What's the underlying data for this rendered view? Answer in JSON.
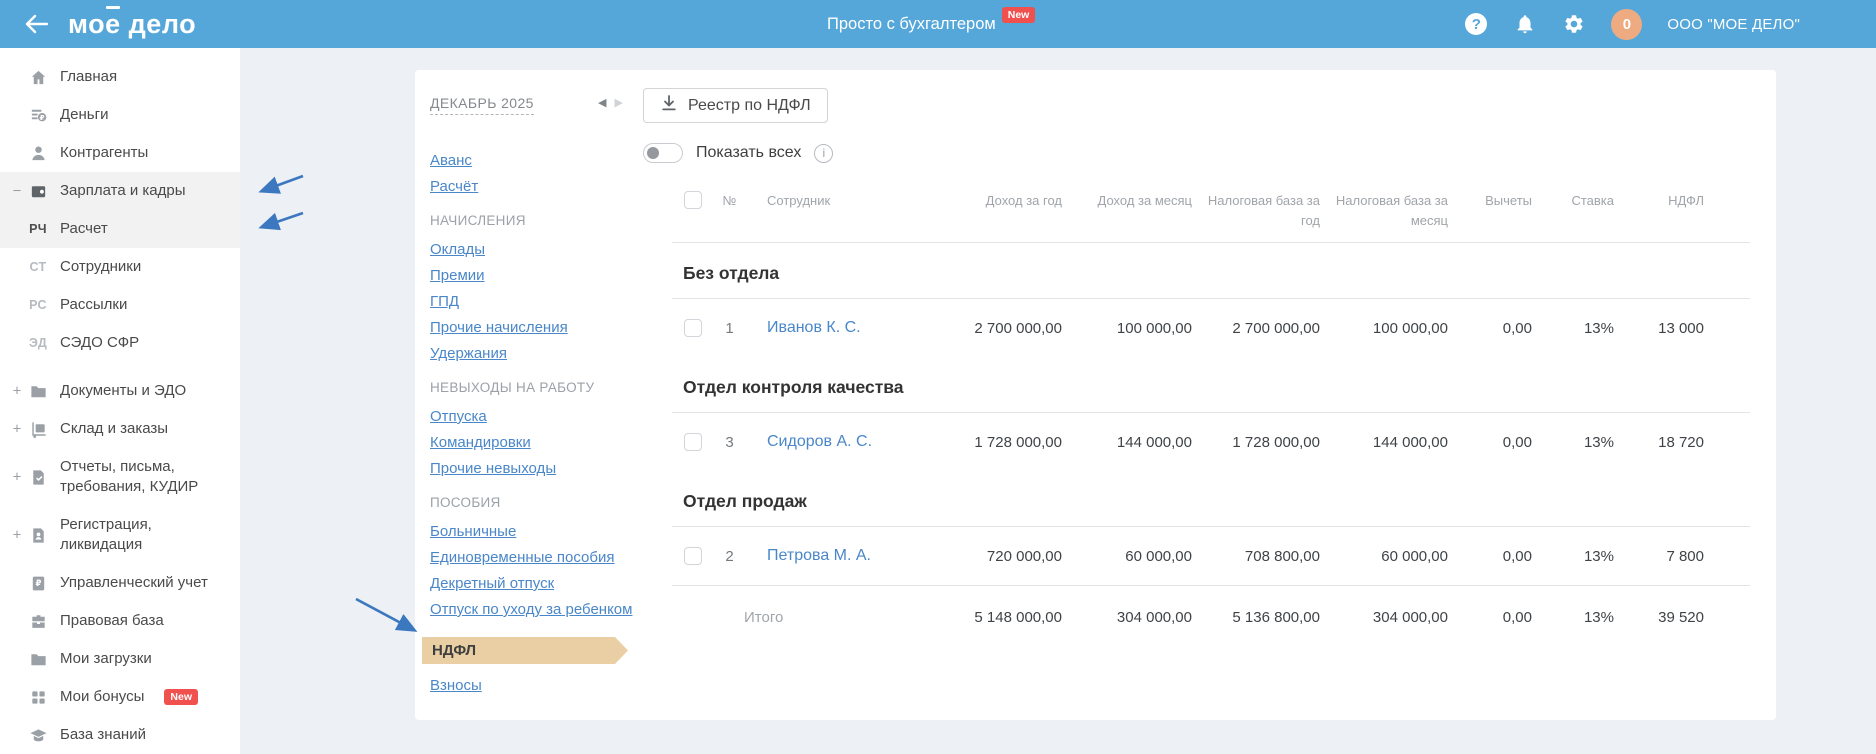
{
  "colors": {
    "header_bg": "#55a7da",
    "badge_red": "#f0504e",
    "link_blue": "#4a87c9",
    "active_tab_bg": "#e9cfa3",
    "annotation_arrow": "#3c78bf",
    "avatar_bg": "#eeab82"
  },
  "header": {
    "logo_pre": "мо",
    "logo_accent": "е",
    "logo_post": " дело",
    "tagline": "Просто с бухгалтером",
    "tagline_badge": "New",
    "avatar_text": "0",
    "company": "ООО \"МОЕ ДЕЛО\""
  },
  "icons": {
    "help": "?",
    "month_prev": "◀",
    "month_next": "▶",
    "info": "i",
    "expander_open": "−",
    "expander_closed": "+"
  },
  "sidebar": {
    "items": [
      {
        "label": "Главная"
      },
      {
        "label": "Деньги"
      },
      {
        "label": "Контрагенты"
      },
      {
        "label": "Зарплата и кадры",
        "expander": "−"
      },
      {
        "label": "Расчет",
        "prefix": "РЧ"
      },
      {
        "label": "Сотрудники",
        "prefix": "СТ"
      },
      {
        "label": "Рассылки",
        "prefix": "РС"
      },
      {
        "label": "СЭДО СФР",
        "prefix": "ЭД"
      },
      {
        "label": "Документы и ЭДО",
        "expander": "+"
      },
      {
        "label": "Склад и заказы",
        "expander": "+"
      },
      {
        "label": "Отчеты, письма, требования, КУДИР",
        "expander": "+"
      },
      {
        "label": "Регистрация, ликвидация",
        "expander": "+"
      },
      {
        "label": "Управленческий учет"
      },
      {
        "label": "Правовая база"
      },
      {
        "label": "Мои загрузки"
      },
      {
        "label": "Мои бонусы",
        "badge": "New"
      },
      {
        "label": "База знаний"
      }
    ]
  },
  "payroll_nav": {
    "month": "ДЕКАБРЬ 2025",
    "top_links": [
      "Аванс",
      "Расчёт"
    ],
    "sections": [
      {
        "title": "НАЧИСЛЕНИЯ",
        "links": [
          "Оклады",
          "Премии",
          "ГПД",
          "Прочие начисления",
          "Удержания"
        ]
      },
      {
        "title": "НЕВЫХОДЫ НА РАБОТУ",
        "links": [
          "Отпуска",
          "Командировки",
          "Прочие невыходы"
        ]
      },
      {
        "title": "ПОСОБИЯ",
        "links": [
          "Больничные",
          "Единовременные пособия",
          "Декретный отпуск",
          "Отпуск по уходу за ребенком"
        ]
      }
    ],
    "active_item": "НДФЛ",
    "bottom_link": "Взносы"
  },
  "toolbar": {
    "export_button": "Реестр по НДФЛ",
    "toggle_label": "Показать всех"
  },
  "table": {
    "columns": [
      "№",
      "Сотрудник",
      "Доход за год",
      "Доход за месяц",
      "Налоговая база за год",
      "Налоговая база за месяц",
      "Вычеты",
      "Ставка",
      "НДФЛ"
    ],
    "groups": [
      {
        "name": "Без отдела",
        "rows": [
          {
            "num": "1",
            "employee": "Иванов К. С.",
            "values": [
              "2 700 000,00",
              "100 000,00",
              "2 700 000,00",
              "100 000,00",
              "0,00",
              "13%",
              "13 000"
            ]
          }
        ]
      },
      {
        "name": "Отдел контроля качества",
        "rows": [
          {
            "num": "3",
            "employee": "Сидоров А. С.",
            "values": [
              "1 728 000,00",
              "144 000,00",
              "1 728 000,00",
              "144 000,00",
              "0,00",
              "13%",
              "18 720"
            ]
          }
        ]
      },
      {
        "name": "Отдел продаж",
        "rows": [
          {
            "num": "2",
            "employee": "Петрова М. А.",
            "values": [
              "720 000,00",
              "60 000,00",
              "708 800,00",
              "60 000,00",
              "0,00",
              "13%",
              "7 800"
            ]
          }
        ]
      }
    ],
    "total": {
      "label": "Итого",
      "values": [
        "5 148 000,00",
        "304 000,00",
        "5 136 800,00",
        "304 000,00",
        "0,00",
        "13%",
        "39 520"
      ]
    }
  }
}
